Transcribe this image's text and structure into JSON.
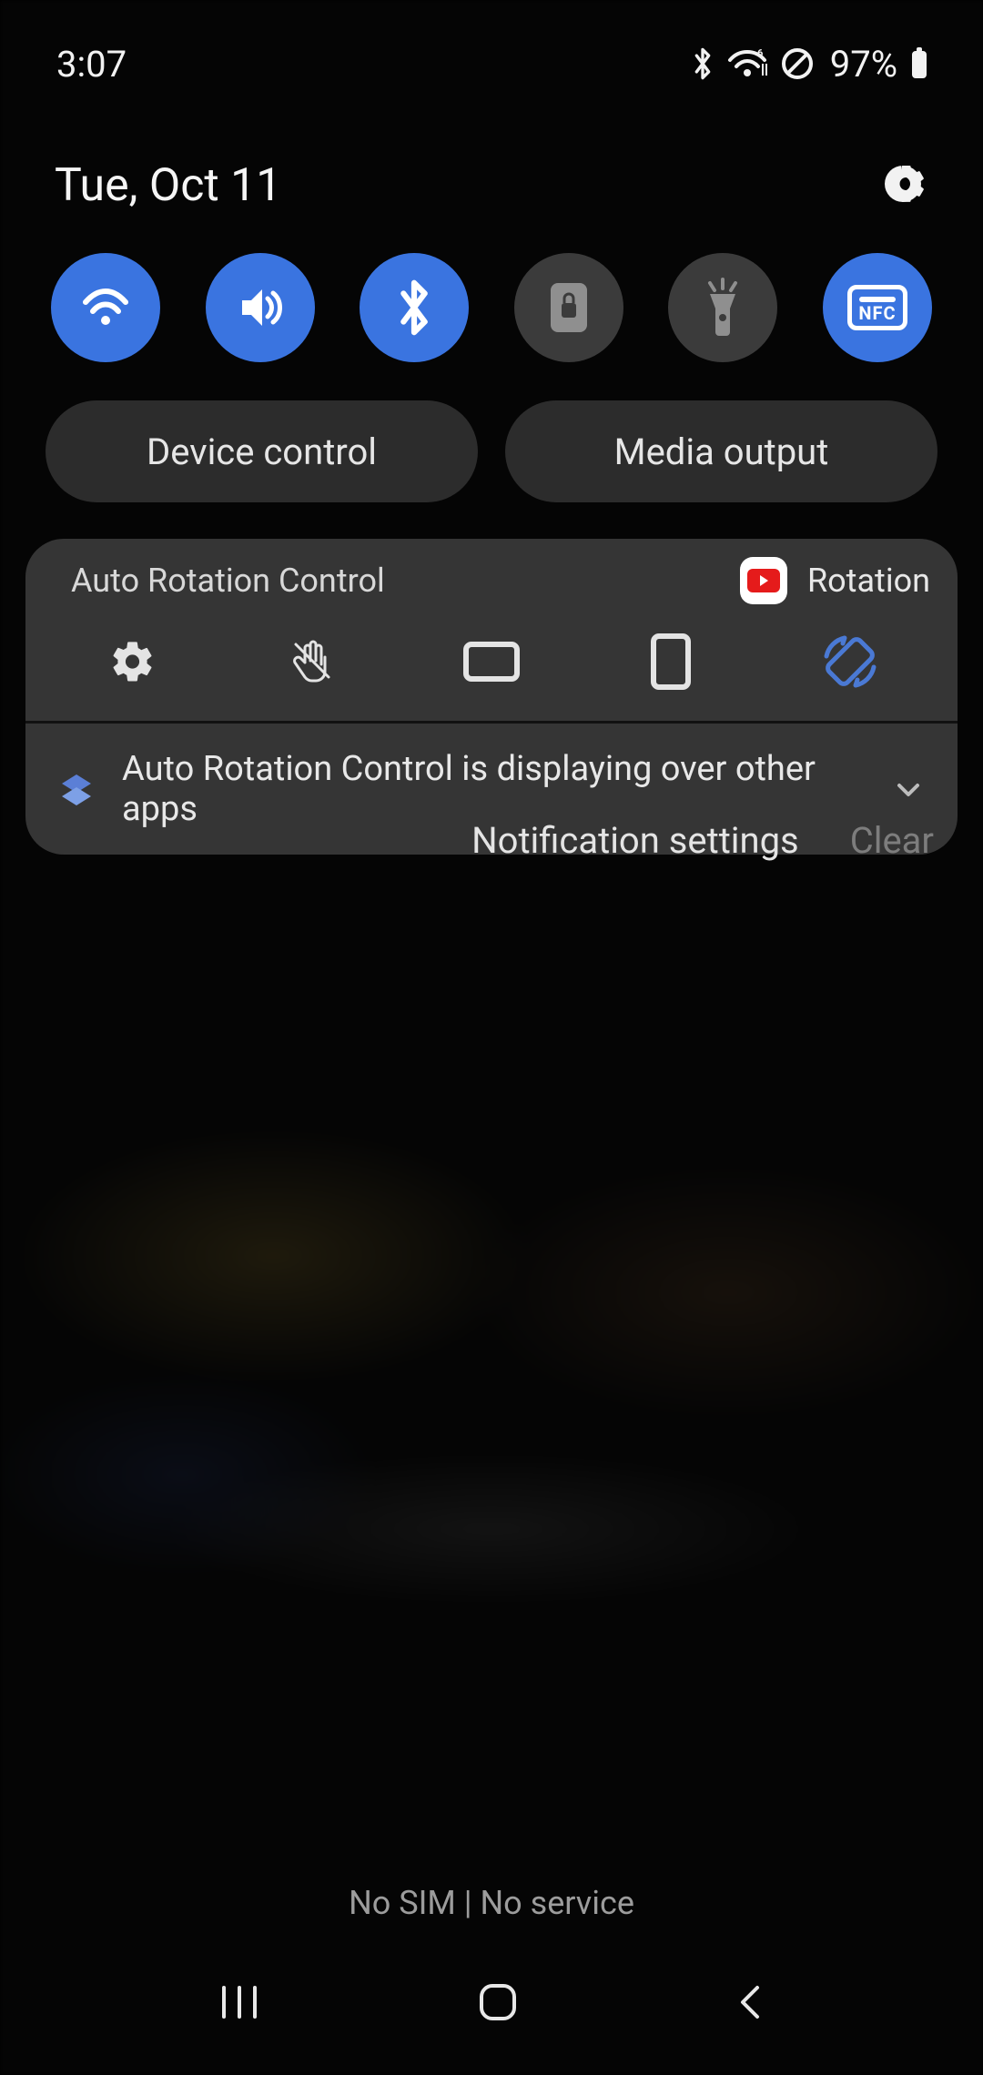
{
  "status": {
    "time": "3:07",
    "battery_pct": "97%",
    "icons": {
      "bluetooth": "bluetooth-icon",
      "wifi": "wifi-icon",
      "dnd": "do-not-disturb-icon",
      "battery": "battery-icon"
    }
  },
  "header": {
    "date": "Tue, Oct 11",
    "settings_icon": "gear-icon"
  },
  "toggles": [
    {
      "name": "wifi",
      "label": "Wi-Fi",
      "active": true
    },
    {
      "name": "sound",
      "label": "Sound",
      "active": true
    },
    {
      "name": "bluetooth",
      "label": "Bluetooth",
      "active": true
    },
    {
      "name": "lock",
      "label": "Rotation lock",
      "active": false
    },
    {
      "name": "flashlight",
      "label": "Flashlight",
      "active": false
    },
    {
      "name": "nfc",
      "label": "NFC",
      "active": true
    }
  ],
  "pills": {
    "device_control": "Device control",
    "media_output": "Media output"
  },
  "notification": {
    "app_title": "Auto Rotation Control",
    "right_label": "Rotation",
    "controls": [
      "settings",
      "no-touch",
      "landscape",
      "portrait",
      "auto-rotate"
    ],
    "overlay_text": "Auto Rotation Control is displaying over other apps"
  },
  "footer": {
    "notification_settings": "Notification settings",
    "clear": "Clear"
  },
  "carrier": {
    "text": "No SIM | No service"
  },
  "colors": {
    "accent": "#3a74e0",
    "active_auto_rotate": "#4a79d4"
  },
  "nfc_text": "NFC"
}
